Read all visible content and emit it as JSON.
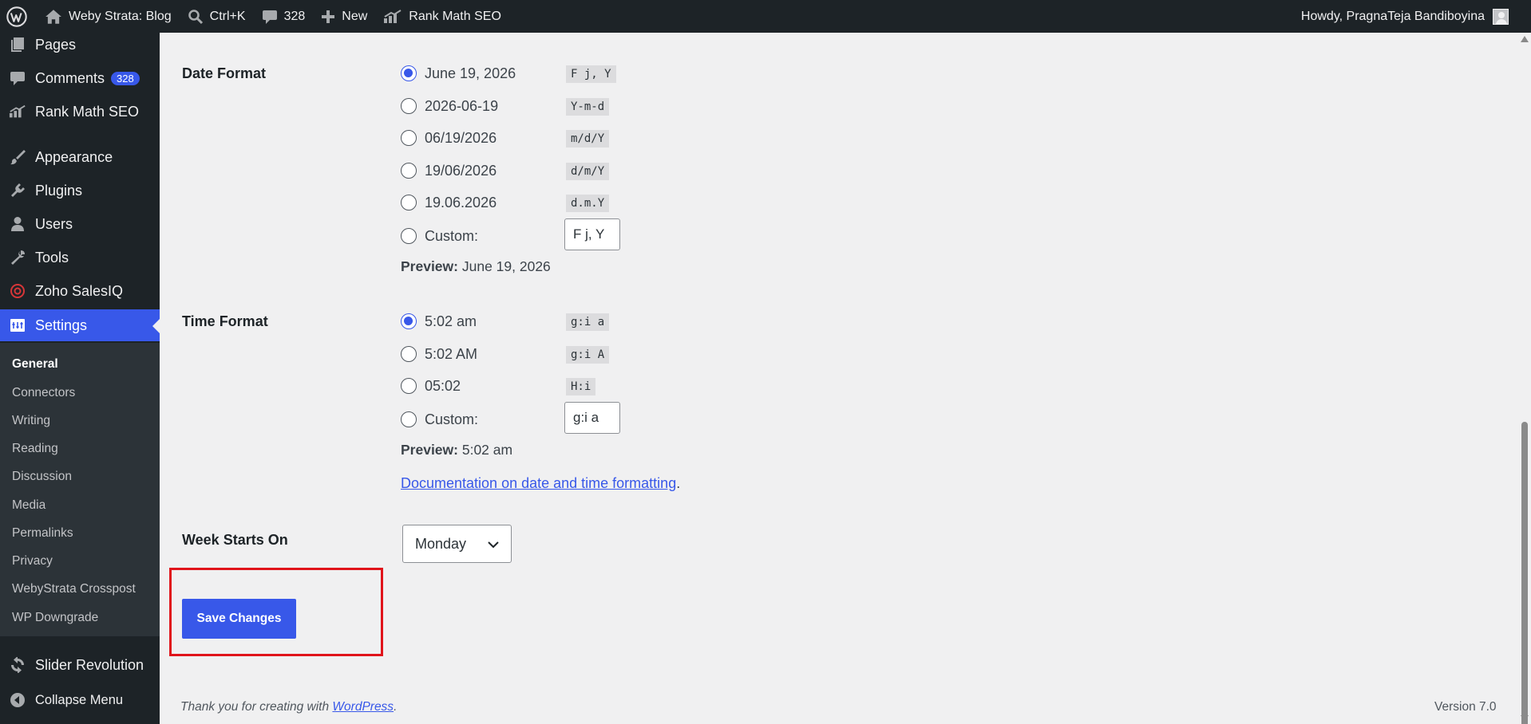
{
  "adminbar": {
    "site_name": "Weby Strata: Blog",
    "search_shortcut": "Ctrl+K",
    "comments_count": "328",
    "new_label": "New",
    "rankmath_label": "Rank Math SEO",
    "howdy": "Howdy, PragnaTeja Bandiboyina"
  },
  "sidebar": {
    "pages": "Pages",
    "comments": "Comments",
    "comments_badge": "328",
    "rankmath": "Rank Math SEO",
    "appearance": "Appearance",
    "plugins": "Plugins",
    "users": "Users",
    "tools": "Tools",
    "zoho": "Zoho SalesIQ",
    "settings": "Settings",
    "submenu": [
      "General",
      "Connectors",
      "Writing",
      "Reading",
      "Discussion",
      "Media",
      "Permalinks",
      "Privacy",
      "WebyStrata Crosspost",
      "WP Downgrade"
    ],
    "slider": "Slider Revolution",
    "collapse": "Collapse Menu"
  },
  "date_format": {
    "label": "Date Format",
    "options": [
      {
        "label": "June 19, 2026",
        "code": "F j, Y",
        "checked": true
      },
      {
        "label": "2026-06-19",
        "code": "Y-m-d",
        "checked": false
      },
      {
        "label": "06/19/2026",
        "code": "m/d/Y",
        "checked": false
      },
      {
        "label": "19/06/2026",
        "code": "d/m/Y",
        "checked": false
      },
      {
        "label": "19.06.2026",
        "code": "d.m.Y",
        "checked": false
      }
    ],
    "custom_label": "Custom:",
    "custom_value": "F j, Y",
    "preview_label": "Preview:",
    "preview_value": "June 19, 2026"
  },
  "time_format": {
    "label": "Time Format",
    "options": [
      {
        "label": "5:02 am",
        "code": "g:i a",
        "checked": true
      },
      {
        "label": "5:02 AM",
        "code": "g:i A",
        "checked": false
      },
      {
        "label": "05:02",
        "code": "H:i",
        "checked": false
      }
    ],
    "custom_label": "Custom:",
    "custom_value": "g:i a",
    "preview_label": "Preview:",
    "preview_value": "5:02 am"
  },
  "doc_link": "Documentation on date and time formatting",
  "doc_link_suffix": ".",
  "week_starts": {
    "label": "Week Starts On",
    "value": "Monday"
  },
  "save_button": "Save Changes",
  "footer": {
    "thanks_prefix": "Thank you for creating with ",
    "thanks_link": "WordPress",
    "thanks_suffix": ".",
    "version": "Version 7.0"
  },
  "colors": {
    "accent": "#3858e9",
    "adminbar_bg": "#1d2327",
    "highlight": "#e0141b"
  }
}
